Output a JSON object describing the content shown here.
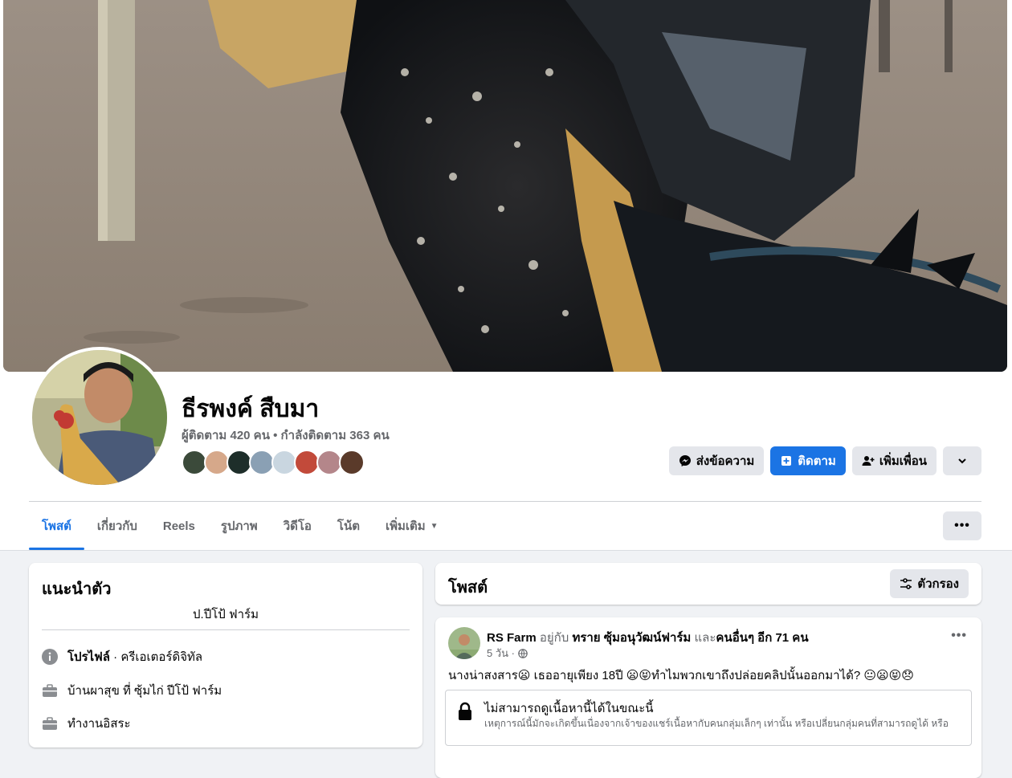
{
  "profile": {
    "name": "ธีรพงค์ สืบมา",
    "stats": "ผู้ติดตาม 420 คน • กำลังติดตาม 363 คน"
  },
  "actions": {
    "message_label": "ส่งข้อความ",
    "follow_label": "ติดตาม",
    "add_friend_label": "เพิ่มเพื่อน",
    "more_icon": "chevron-down-icon"
  },
  "tabs": [
    {
      "label": "โพสต์",
      "active": true
    },
    {
      "label": "เกี่ยวกับ"
    },
    {
      "label": "Reels"
    },
    {
      "label": "รูปภาพ"
    },
    {
      "label": "วิดีโอ"
    },
    {
      "label": "โน้ต"
    },
    {
      "label": "เพิ่มเติม"
    }
  ],
  "intro": {
    "title": "แนะนำตัว",
    "bio": "ป.ปีโป้ ฟาร์ม",
    "profile_label": "โปรไฟล์",
    "profile_category": " · ครีเอเตอร์ดิจิทัล",
    "lives": "บ้านผาสุข ที่ ซุ้มไก่ ปีโป้ ฟาร์ม",
    "work": "ทำงานอิสระ"
  },
  "posts": {
    "title": "โพสต์",
    "filter_label": "ตัวกรอง"
  },
  "post": {
    "author": "RS Farm",
    "with_text": " อยู่กับ ",
    "tagged": "ทราย ซุ้มอนุวัฒน์ฟาร์ม",
    "and_text": " และ",
    "others": "คนอื่นๆ อีก 71 คน",
    "time": "5 วัน ·",
    "text": "นางน่าสงสาร😦 เธออายุเพียง 18ปี 😦😝ทำไมพวกเขาถึงปล่อยคลิปนั้นออกมาได้? 😐😦😝😞",
    "blocked_title": "ไม่สามารถดูเนื้อหานี้ได้ในขณะนี้",
    "blocked_desc": "เหตุการณ์นี้มักจะเกิดขึ้นเนื่องจากเจ้าของแชร์เนื้อหากับคนกลุ่มเล็กๆ เท่านั้น หรือเปลี่ยนกลุ่มคนที่สามารถดูได้ หรือ"
  },
  "colors": {
    "accent": "#1b74e4",
    "button_grey": "#e4e6eb",
    "muted_text": "#65676b"
  }
}
